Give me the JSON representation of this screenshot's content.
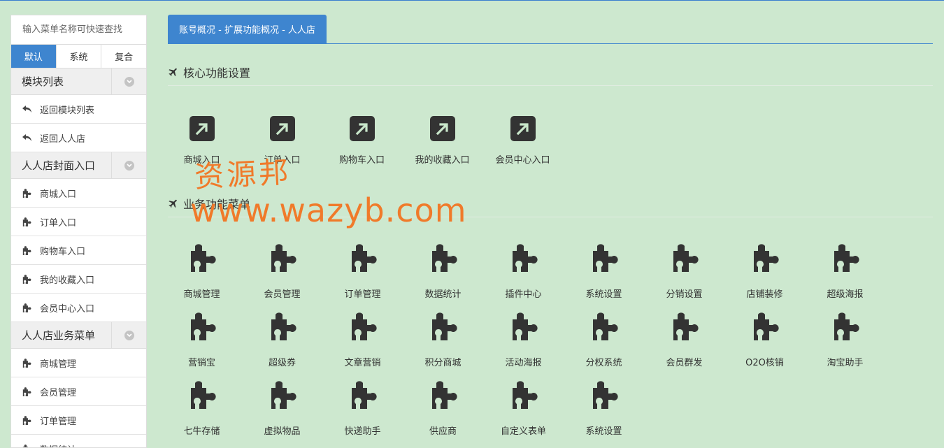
{
  "sidebar": {
    "search_placeholder": "输入菜单名称可快速查找",
    "tabs": [
      "默认",
      "系统",
      "复合"
    ],
    "groups": [
      {
        "title": "模块列表",
        "items": [
          "返回模块列表",
          "返回人人店"
        ]
      },
      {
        "title": "人人店封面入口",
        "items": [
          "商城入口",
          "订单入口",
          "购物车入口",
          "我的收藏入口",
          "会员中心入口"
        ]
      },
      {
        "title": "人人店业务菜单",
        "items": [
          "商城管理",
          "会员管理",
          "订单管理",
          "数据统计"
        ]
      }
    ]
  },
  "breadcrumb": "账号概况 - 扩展功能概况 - 人人店",
  "core_section": {
    "title": "核心功能设置",
    "tiles": [
      "商城入口",
      "订单入口",
      "购物车入口",
      "我的收藏入口",
      "会员中心入口"
    ]
  },
  "business_section": {
    "title": "业务功能菜单",
    "rows": [
      [
        "商城管理",
        "会员管理",
        "订单管理",
        "数据统计",
        "插件中心",
        "系统设置",
        "分销设置",
        "店铺装修",
        "超级海报"
      ],
      [
        "营销宝",
        "超级券",
        "文章营销",
        "积分商城",
        "活动海报",
        "分权系统",
        "会员群发",
        "O2O核销",
        "淘宝助手"
      ],
      [
        "七牛存储",
        "虚拟物品",
        "快递助手",
        "供应商",
        "自定义表单",
        "系统设置"
      ]
    ]
  },
  "watermark": {
    "line1": "资源邦",
    "line2": "www.wazyb.com"
  },
  "colors": {
    "accent": "#3e85cf",
    "background": "#cde8cf",
    "watermark": "#f07a2a"
  }
}
